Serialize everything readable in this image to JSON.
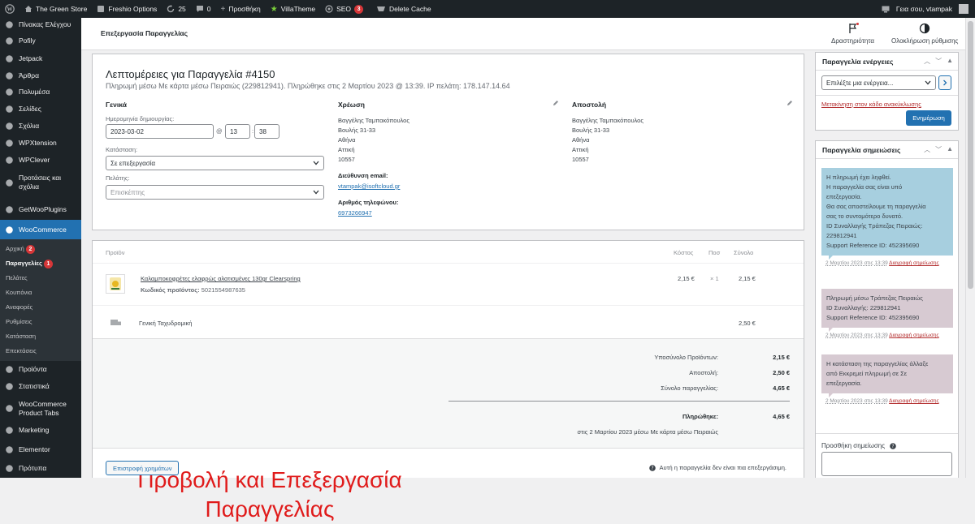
{
  "adminbar": {
    "site": "The Green Store",
    "freshio": "Freshio Options",
    "updates": "25",
    "comments": "0",
    "new": "Προσθήκη",
    "villatheme": "VillaTheme",
    "seo": "SEO",
    "seo_count": "3",
    "delete_cache": "Delete Cache",
    "greeting": "Γεια σου, vtampak"
  },
  "sidebar": {
    "items": [
      {
        "label": "Πίνακας Ελέγχου",
        "icon": "dashboard-icon"
      },
      {
        "label": "Pofily",
        "icon": "pofily-icon"
      },
      {
        "label": "Jetpack",
        "icon": "jetpack-icon"
      },
      {
        "label": "Άρθρα",
        "icon": "pin-icon"
      },
      {
        "label": "Πολυμέσα",
        "icon": "media-icon"
      },
      {
        "label": "Σελίδες",
        "icon": "page-icon"
      },
      {
        "label": "Σχόλια",
        "icon": "comment-icon"
      },
      {
        "label": "WPXtension",
        "icon": "wpxtension-icon"
      },
      {
        "label": "WPClever",
        "icon": "wpclever-icon"
      },
      {
        "label": "Προτάσεις και σχόλια",
        "icon": "feedback-icon"
      },
      {
        "label": "GetWooPlugins",
        "icon": "getwoo-icon"
      },
      {
        "label": "WooCommerce",
        "icon": "woo-icon"
      }
    ],
    "woo_sub": [
      {
        "label": "Αρχική",
        "badge": "2"
      },
      {
        "label": "Παραγγελίες",
        "badge": "1"
      },
      {
        "label": "Πελάτες"
      },
      {
        "label": "Κουπόνια"
      },
      {
        "label": "Αναφορές"
      },
      {
        "label": "Ρυθμίσεις"
      },
      {
        "label": "Κατάσταση"
      },
      {
        "label": "Επεκτάσεις"
      }
    ],
    "after": [
      {
        "label": "Προϊόντα",
        "icon": "products-icon"
      },
      {
        "label": "Στατιστικά",
        "icon": "stats-icon"
      },
      {
        "label": "WooCommerce Product Tabs",
        "icon": "tabs-icon"
      },
      {
        "label": "Marketing",
        "icon": "marketing-icon"
      },
      {
        "label": "Elementor",
        "icon": "elementor-icon"
      },
      {
        "label": "Πρότυπα",
        "icon": "templates-icon"
      }
    ]
  },
  "header": {
    "title": "Επεξεργασία Παραγγελίας",
    "activity": "Δραστηριότητα",
    "setup": "Ολοκλήρωση ρύθμισης"
  },
  "order": {
    "heading": "Λεπτομέρειες για Παραγγελία #4150",
    "payment_info": "Πληρωμή μέσω Με κάρτα μέσω Πειραιώς (229812941). Πληρώθηκε στις 2 Μαρτίου 2023 @ 13:39. IP πελάτη: 178.147.14.64",
    "general": {
      "title": "Γενικά",
      "date_label": "Ημερομηνία δημιουργίας:",
      "date": "2023-03-02",
      "at": "@",
      "hour": "13",
      "minute": "38",
      "status_label": "Κατάσταση:",
      "status": "Σε επεξεργασία",
      "customer_label": "Πελάτης:",
      "customer": "Επισκέπτης"
    },
    "billing": {
      "title": "Χρέωση",
      "lines": [
        "Βαγγέλης Ταμπακόπουλος",
        "Βουλής 31-33",
        "Αθήνα",
        "Αττική",
        "10557"
      ],
      "email_label": "Διεύθυνση email:",
      "email": "vtampak@isoftcloud.gr",
      "phone_label": "Αριθμός τηλεφώνου:",
      "phone": "6973266947"
    },
    "shipping": {
      "title": "Αποστολή",
      "lines": [
        "Βαγγέλης Ταμπακόπουλος",
        "Βουλής 31-33",
        "Αθήνα",
        "Αττική",
        "10557"
      ]
    }
  },
  "items": {
    "headers": {
      "product": "Προϊόν",
      "cost": "Κόστος",
      "qty": "Ποσ",
      "total": "Σύνολο"
    },
    "product": {
      "name": "Καλαμποκοφρέτες ελαφρώς αλατισμένες 130gr Clearspring",
      "sku_label": "Κωδικός προϊόντος:",
      "sku": "5021554987635",
      "cost": "2,15 €",
      "qty": "× 1",
      "total": "2,15 €"
    },
    "shipping": {
      "name": "Γενική Ταχυδρομική",
      "total": "2,50 €"
    },
    "totals": {
      "subtotal_label": "Υποσύνολο Προϊόντων:",
      "subtotal": "2,15 €",
      "shipping_label": "Αποστολή:",
      "shipping": "2,50 €",
      "order_total_label": "Σύνολο παραγγελίας:",
      "order_total": "4,65 €",
      "paid_label": "Πληρώθηκε:",
      "paid": "4,65 €",
      "paid_note": "στις 2 Μαρτίου 2023 μέσω Με κάρτα μέσω Πειραιώς"
    },
    "refund_button": "Επιστροφή χρημάτων",
    "not_editable": "Αυτή η παραγγελία δεν είναι πια επεξεργάσιμη."
  },
  "overlay_text": [
    "Προβολή και Επεξεργασία",
    "Παραγγελίας"
  ],
  "actions_box": {
    "title": "Παραγγελία ενέργειες",
    "select": "Επιλέξτε μια ενέργεια...",
    "trash": "Μετακίνηση στον κάδο ανακύκλωσης",
    "update": "Ενημέρωση"
  },
  "notes_box": {
    "title": "Παραγγελία σημειώσεις",
    "notes": [
      {
        "lines": [
          "Η πληρωμή έχει ληφθεί.",
          "Η παραγγελία σας είναι υπό",
          "επεξεργασία.",
          "Θα σας αποστείλουμε τη παραγγελία",
          "σας το συντομότερο δυνατό.",
          "ID Συναλλαγής Τράπεζας Πειραιώς:",
          "229812941",
          "Support Reference ID: 452395690"
        ],
        "meta": "2 Μαρτίου 2023 στις 13:39",
        "delete": "Διαγραφή σημείωσης",
        "color": "#a7cfdf"
      },
      {
        "lines": [
          "Πληρωμή μέσω Τράπεζας Πειραιώς",
          "ID Συναλλαγής: 229812941",
          "Support Reference ID: 452395690"
        ],
        "meta": "2 Μαρτίου 2023 στις 13:39",
        "delete": "Διαγραφή σημείωσης",
        "color": "#d7cad2"
      },
      {
        "lines": [
          "Η κατάσταση της παραγγελίας άλλαξε",
          "από Εκκρεμεί πληρωμή σε Σε",
          "επεξεργασία."
        ],
        "meta": "2 Μαρτίου 2023 στις 13:39",
        "delete": "Διαγραφή σημείωσης",
        "color": "#d7cad2"
      }
    ],
    "add_label": "Προσθήκη σημείωσης"
  },
  "colors": {
    "accent": "#2271b1",
    "admin_dark": "#1d2327",
    "overlay_red": "#e01b1b"
  }
}
